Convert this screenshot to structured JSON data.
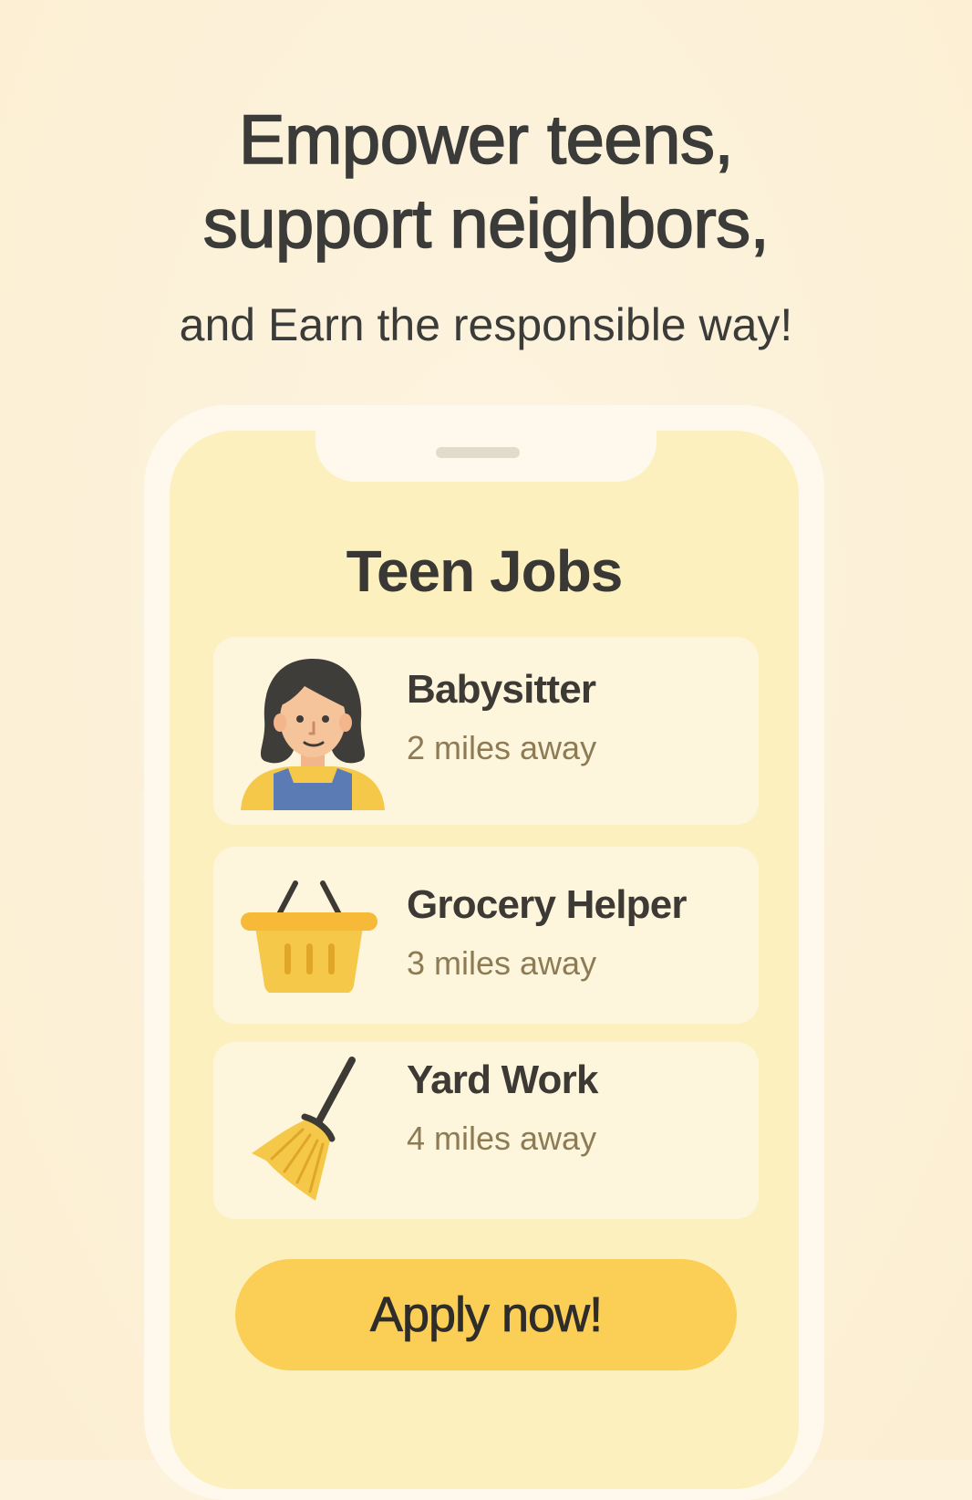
{
  "headline": {
    "line1": "Empower teens,",
    "line2": "support neighbors,",
    "subline": "and Earn the responsible way!"
  },
  "app": {
    "title": "Teen Jobs",
    "jobs": [
      {
        "title": "Babysitter",
        "distance": "2 miles away",
        "icon": "babysitter-icon"
      },
      {
        "title": "Grocery Helper",
        "distance": "3 miles away",
        "icon": "shopping-basket-icon"
      },
      {
        "title": "Yard Work",
        "distance": "4 miles away",
        "icon": "broom-icon"
      }
    ],
    "apply_label": "Apply now!"
  },
  "colors": {
    "background": "#fdf3dd",
    "screen": "#fdf0bf",
    "accent": "#fbcf55",
    "text": "#3b3b39",
    "muted": "#8d7b55"
  }
}
